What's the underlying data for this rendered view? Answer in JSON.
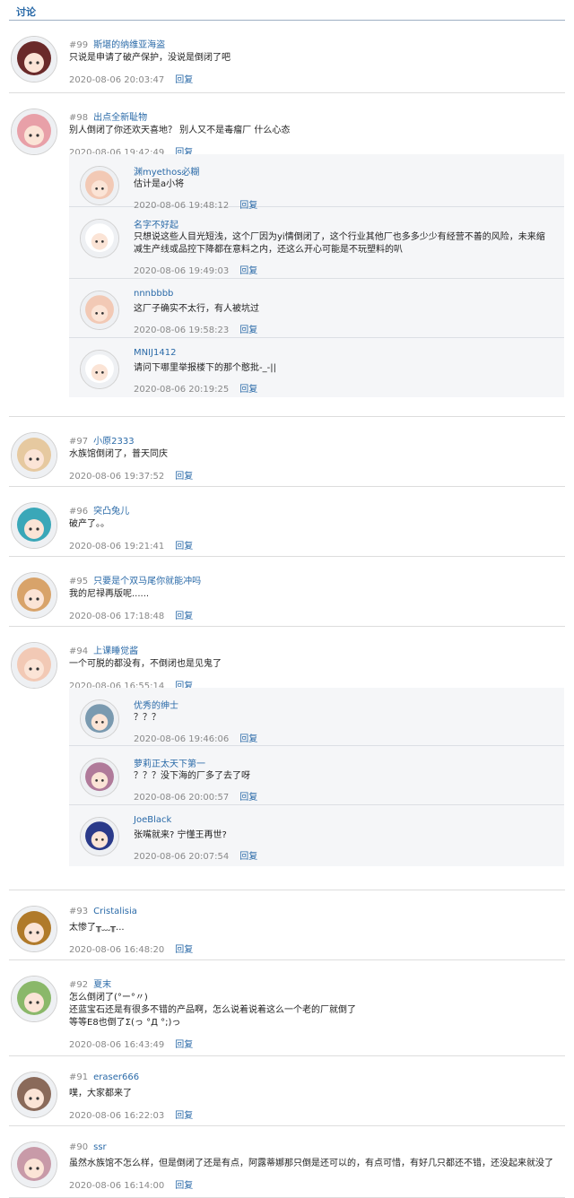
{
  "header": {
    "title": "讨论"
  },
  "comments": [
    {
      "floor": "#99",
      "user": "斯堪的纳维亚海盗",
      "text": [
        "只说是申请了破产保护，没说是倒闭了吧"
      ],
      "time": "2020-08-06 20:03:47",
      "reply_label": "回复",
      "avatar_color": "#6a2a2a",
      "replies": []
    },
    {
      "floor": "#98",
      "user": "出点全新耻物",
      "text": [
        "别人倒闭了你还欢天喜地？ 别人又不是毒瘤厂 什么心态"
      ],
      "time": "2020-08-06 19:42:49",
      "reply_label": "回复",
      "avatar_color": "#e8a0a8",
      "replies": [
        {
          "user": "渊myethos必糊",
          "text": [
            "估计是a小将"
          ],
          "time": "2020-08-06 19:48:12",
          "reply_label": "回复",
          "avatar_color": "#f2c9b5"
        },
        {
          "user": "名字不好起",
          "text": [
            "只想说这些人目光短浅，这个厂因为yi情倒闭了，这个行业其他厂也多多少少有经营不善的风险，未来缩",
            "减生产线或品控下降都在意料之内，还这么开心可能是不玩塑料的叭"
          ],
          "time": "2020-08-06 19:49:03",
          "reply_label": "回复",
          "avatar_color": "#ffffff"
        },
        {
          "user": "nnnbbbb",
          "text": [
            "这厂子确实不太行，有人被坑过"
          ],
          "time": "2020-08-06 19:58:23",
          "reply_label": "回复",
          "avatar_color": "#f2c9b5"
        },
        {
          "user": "MNIJ1412",
          "text": [
            "请问下哪里举报楼下的那个憨批-_-||"
          ],
          "time": "2020-08-06 20:19:25",
          "reply_label": "回复",
          "avatar_color": "#ffffff"
        }
      ]
    },
    {
      "floor": "#97",
      "user": "小原2333",
      "text": [
        "水族馆倒闭了，普天同庆"
      ],
      "time": "2020-08-06 19:37:52",
      "reply_label": "回复",
      "avatar_color": "#e6c9a0",
      "replies": []
    },
    {
      "floor": "#96",
      "user": "突凸兔儿",
      "text": [
        "破产了。。"
      ],
      "time": "2020-08-06 19:21:41",
      "reply_label": "回复",
      "avatar_color": "#3aa7b8",
      "replies": []
    },
    {
      "floor": "#95",
      "user": "只要是个双马尾你就能冲吗",
      "text": [
        "我的尼禄再版呢......"
      ],
      "time": "2020-08-06 17:18:48",
      "reply_label": "回复",
      "avatar_color": "#d8a36a",
      "replies": []
    },
    {
      "floor": "#94",
      "user": "上课睡觉酱",
      "text": [
        "一个可脱的都没有，不倒闭也是见鬼了"
      ],
      "time": "2020-08-06 16:55:14",
      "reply_label": "回复",
      "avatar_color": "#f2c9b5",
      "replies": [
        {
          "user": "优秀的绅士",
          "text": [
            "？？？"
          ],
          "time": "2020-08-06 19:46:06",
          "reply_label": "回复",
          "avatar_color": "#7a9ab0"
        },
        {
          "user": "萝莉正太天下第一",
          "text": [
            "？？？没下海的厂多了去了呀"
          ],
          "time": "2020-08-06 20:00:57",
          "reply_label": "回复",
          "avatar_color": "#b07a9a"
        },
        {
          "user": "JoeBlack",
          "text": [
            "张嘴就来? 宁懂王再世?"
          ],
          "time": "2020-08-06 20:07:54",
          "reply_label": "回复",
          "avatar_color": "#2a3a8a"
        }
      ]
    },
    {
      "floor": "#93",
      "user": "Cristalisia",
      "text": [
        "太惨了╥﹏╥..."
      ],
      "time": "2020-08-06 16:48:20",
      "reply_label": "回复",
      "avatar_color": "#b07a2a",
      "replies": []
    },
    {
      "floor": "#92",
      "user": "夏末",
      "text": [
        "怎么倒闭了(°ー°〃)",
        "还蓝宝石还是有很多不错的产品啊，怎么说着说着这么一个老的厂就倒了",
        "等等E8也倒了Σ(っ °Д °;)っ"
      ],
      "time": "2020-08-06 16:43:49",
      "reply_label": "回复",
      "avatar_color": "#8ab86a",
      "replies": []
    },
    {
      "floor": "#91",
      "user": "eraser666",
      "text": [
        "噗，大家都来了"
      ],
      "time": "2020-08-06 16:22:03",
      "reply_label": "回复",
      "avatar_color": "#8a6a5a",
      "replies": []
    },
    {
      "floor": "#90",
      "user": "ssr",
      "text": [
        "虽然水族馆不怎么样，但是倒闭了还是有点，阿露蒂娜那只倒是还可以的，有点可惜，有好几只都还不错，还没起来就没了"
      ],
      "time": "2020-08-06 16:14:00",
      "reply_label": "回复",
      "avatar_color": "#c89aa8",
      "replies": []
    }
  ]
}
